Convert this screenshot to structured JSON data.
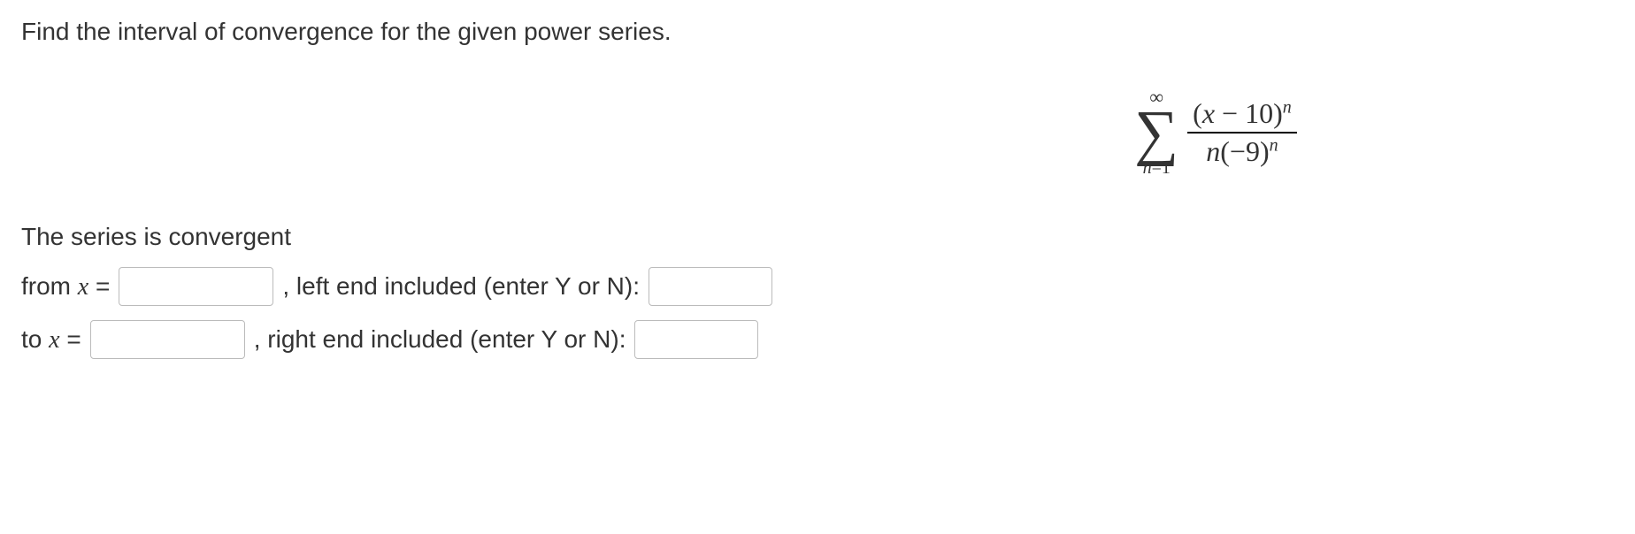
{
  "prompt": "Find the interval of convergence for the given power series.",
  "formula": {
    "sigma_top": "∞",
    "sigma_bottom_var": "n",
    "sigma_bottom_eq": "=1",
    "numerator_open": "(",
    "numerator_var": "x",
    "numerator_rest": " − 10)",
    "numerator_exp": "n",
    "denominator_var": "n",
    "denominator_open": "(−9)",
    "denominator_exp": "n"
  },
  "convergent_label": "The series is convergent",
  "row1": {
    "prefix": "from ",
    "var": "x",
    "equals": " = ",
    "mid": ", left end included (enter Y or N):"
  },
  "row2": {
    "prefix": "to ",
    "var": "x",
    "equals": " = ",
    "mid": ", right end included (enter Y or N):"
  }
}
